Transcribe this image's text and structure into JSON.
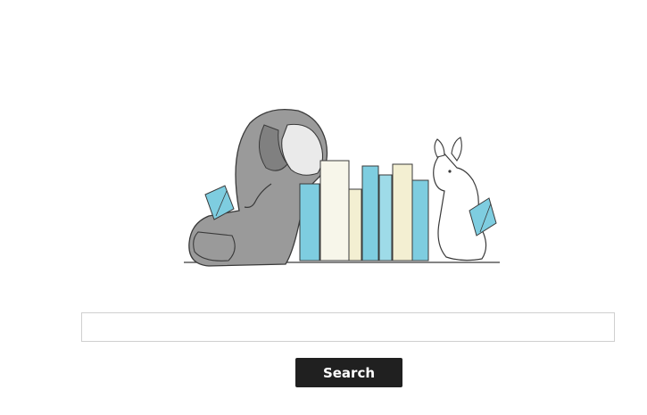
{
  "illustration": {
    "subjects": [
      "elephant-reading",
      "books",
      "bunny-reading"
    ],
    "colors": {
      "elephant": "#8f8f8f",
      "book_blue": "#7ecde0",
      "book_cream": "#f3efd2",
      "outline": "#3a3a3a"
    }
  },
  "search": {
    "value": "",
    "placeholder": "",
    "button_label": "Search"
  },
  "colors": {
    "button_bg": "#202020",
    "button_text": "#ffffff",
    "input_border": "#cfcfcf"
  }
}
